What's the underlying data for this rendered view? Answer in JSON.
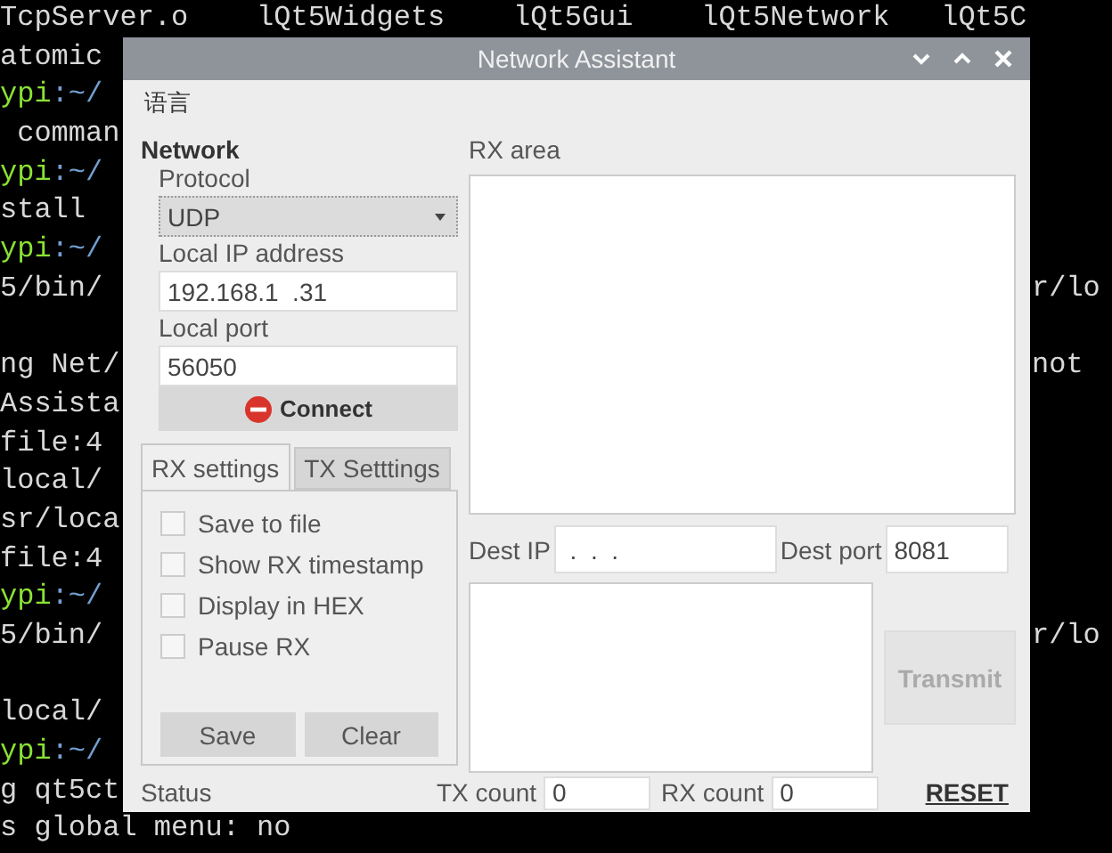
{
  "terminal": {
    "lines": [
      {
        "kind": "full",
        "full": "TcpServer.o    lQt5Widgets    lQt5Gui    lQt5Network   lQt5C"
      },
      {
        "left": [
          {
            "text": "atomic",
            "color": "#d8d8d8"
          }
        ]
      },
      {
        "left": [
          {
            "text": "ypi",
            "color": "#8ae234"
          },
          {
            "text": ":~/",
            "color": "#729fcf"
          }
        ]
      },
      {
        "left": [
          {
            "text": " comman",
            "color": "#d8d8d8"
          }
        ]
      },
      {
        "left": [
          {
            "text": "ypi",
            "color": "#8ae234"
          },
          {
            "text": ":~/",
            "color": "#729fcf"
          }
        ]
      },
      {
        "left": [
          {
            "text": "stall",
            "color": "#d8d8d8"
          }
        ]
      },
      {
        "left": [
          {
            "text": "ypi",
            "color": "#8ae234"
          },
          {
            "text": ":~/",
            "color": "#729fcf"
          }
        ]
      },
      {
        "left": [
          {
            "text": "5/bin/",
            "color": "#d8d8d8"
          }
        ],
        "right": "r/lo"
      },
      {
        "kind": "blank"
      },
      {
        "left": [
          {
            "text": "ng Net/",
            "color": "#d8d8d8"
          }
        ],
        "right": "not"
      },
      {
        "left": [
          {
            "text": "Assista",
            "color": "#d8d8d8"
          }
        ]
      },
      {
        "left": [
          {
            "text": "file:4",
            "color": "#d8d8d8"
          }
        ]
      },
      {
        "left": [
          {
            "text": "local/",
            "color": "#d8d8d8"
          }
        ]
      },
      {
        "left": [
          {
            "text": "sr/loca",
            "color": "#d8d8d8"
          }
        ]
      },
      {
        "left": [
          {
            "text": "file:4",
            "color": "#d8d8d8"
          }
        ]
      },
      {
        "left": [
          {
            "text": "ypi",
            "color": "#8ae234"
          },
          {
            "text": ":~/",
            "color": "#729fcf"
          }
        ]
      },
      {
        "left": [
          {
            "text": "5/bin/",
            "color": "#d8d8d8"
          }
        ],
        "right": "r/lo"
      },
      {
        "kind": "blank"
      },
      {
        "left": [
          {
            "text": "local/",
            "color": "#d8d8d8"
          }
        ]
      },
      {
        "left": [
          {
            "text": "ypi",
            "color": "#8ae234"
          },
          {
            "text": ":~/",
            "color": "#729fcf"
          }
        ]
      },
      {
        "left": [
          {
            "text": "g qt5ct",
            "color": "#d8d8d8"
          }
        ]
      },
      {
        "kind": "full",
        "full": "s global menu: no"
      }
    ]
  },
  "window": {
    "title": "Network Assistant"
  },
  "menu": [
    "语言"
  ],
  "network": {
    "title": "Network",
    "protocol_label": "Protocol",
    "protocol": "UDP",
    "local_ip_label": "Local IP address",
    "local_ip": "192.168.1  .31",
    "local_port_label": "Local port",
    "local_port": "56050",
    "connect": "Connect"
  },
  "tabs": [
    {
      "label": "RX settings",
      "selected": true
    },
    {
      "label": "TX Setttings",
      "selected": false
    }
  ],
  "rx_options": [
    {
      "label": "Save to file",
      "checked": false
    },
    {
      "label": "Show RX timestamp",
      "checked": false
    },
    {
      "label": "Display in HEX",
      "checked": false
    },
    {
      "label": "Pause RX",
      "checked": false
    }
  ],
  "rx_buttons": [
    "Save",
    "Clear"
  ],
  "rx_area_label": "RX area",
  "dest": {
    "ip_label": "Dest IP",
    "ip": " .  .  .",
    "port_label": "Dest port",
    "port": "8081"
  },
  "transmit": {
    "label": "Transmit",
    "disabled": true
  },
  "status_bar": {
    "status": "Status",
    "tx_label": "TX count",
    "tx": "0",
    "rx_label": "RX count",
    "rx": "0",
    "reset": "RESET"
  }
}
